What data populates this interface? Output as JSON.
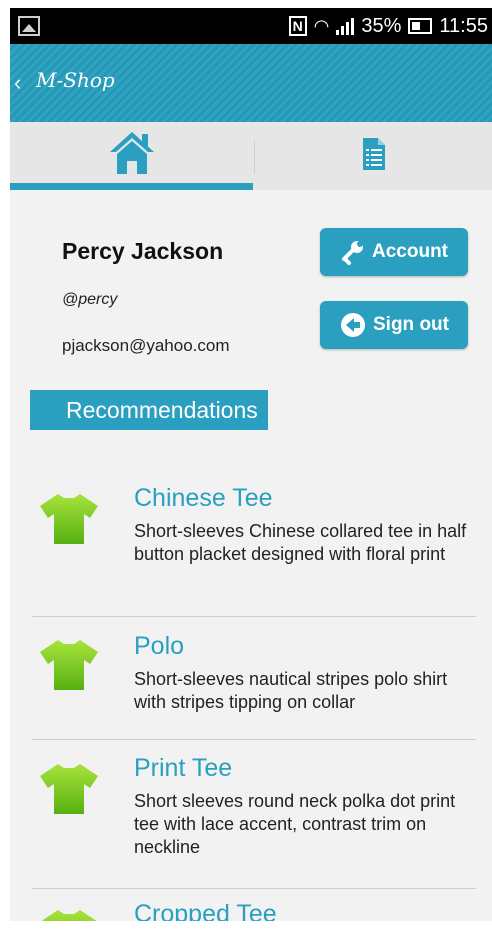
{
  "status_bar": {
    "battery": "35%",
    "time": "11:55"
  },
  "app": {
    "title": "M-Shop"
  },
  "tabs": [
    {
      "icon": "home-icon"
    },
    {
      "icon": "document-list-icon"
    }
  ],
  "profile": {
    "name": "Percy Jackson",
    "handle": "@percy",
    "email": "pjackson@yahoo.com"
  },
  "buttons": {
    "account": "Account",
    "sign_out": "Sign out"
  },
  "recommendations": {
    "header": "Recommendations",
    "items": [
      {
        "title": "Chinese Tee",
        "description": "Short-sleeves Chinese collared tee in half button placket designed with floral print"
      },
      {
        "title": "Polo",
        "description": "Short-sleeves nautical stripes polo shirt  with stripes tipping on collar"
      },
      {
        "title": "Print Tee",
        "description": "Short sleeves round neck polka dot print tee with lace accent, contrast trim on neckline"
      },
      {
        "title": "Cropped Tee",
        "description": ""
      }
    ]
  },
  "colors": {
    "accent": "#2b9fc0",
    "shirt": "#7acb1e"
  }
}
